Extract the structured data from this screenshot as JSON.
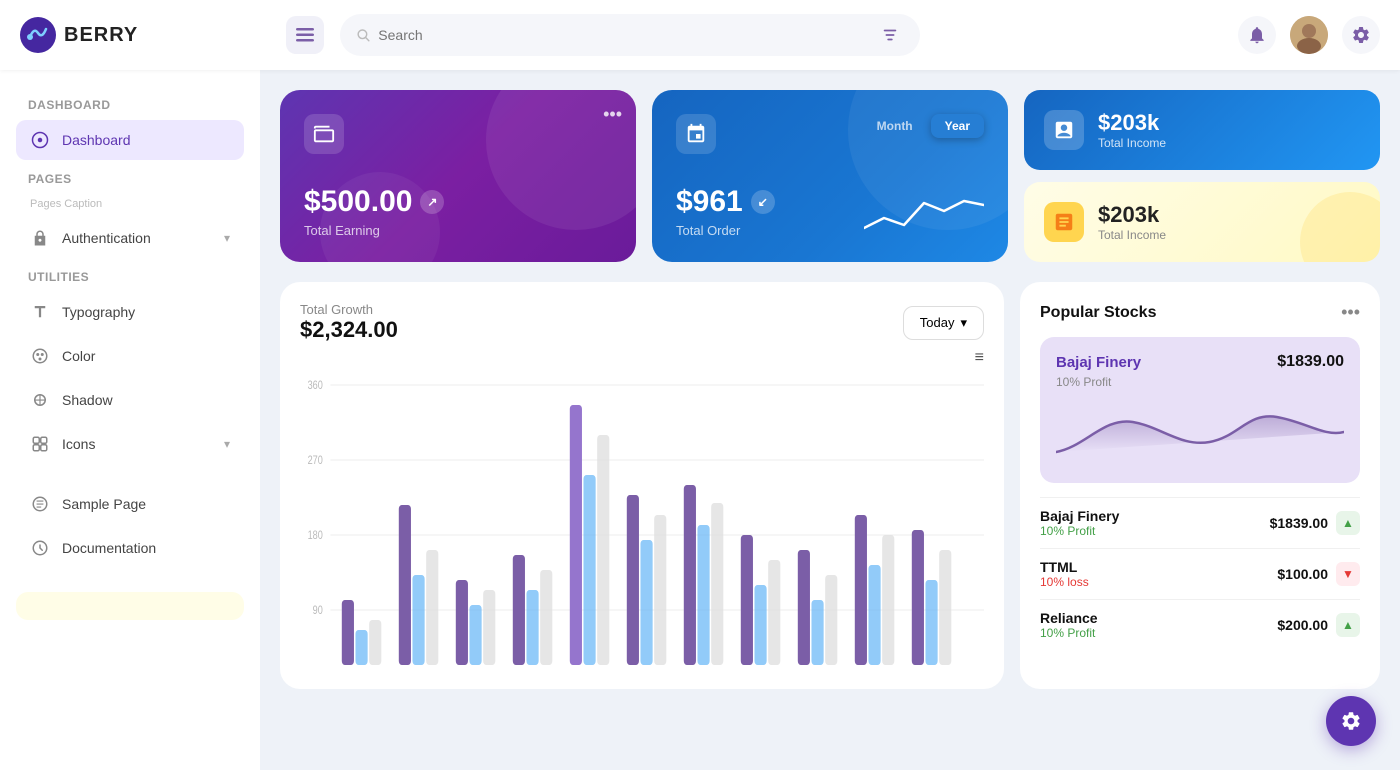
{
  "header": {
    "logo_text": "BERRY",
    "search_placeholder": "Search",
    "hamburger_label": "☰"
  },
  "sidebar": {
    "dashboard_section": "Dashboard",
    "dashboard_item": "Dashboard",
    "pages_section": "Pages",
    "pages_caption": "Pages Caption",
    "auth_item": "Authentication",
    "utilities_section": "Utilities",
    "typography_item": "Typography",
    "color_item": "Color",
    "shadow_item": "Shadow",
    "icons_item": "Icons",
    "sample_page_item": "Sample Page",
    "documentation_item": "Documentation"
  },
  "cards": {
    "earning_amount": "$500.00",
    "earning_label": "Total Earning",
    "order_amount": "$961",
    "order_label": "Total Order",
    "tab_month": "Month",
    "tab_year": "Year",
    "income_blue_amount": "$203k",
    "income_blue_label": "Total Income",
    "income_yellow_amount": "$203k",
    "income_yellow_label": "Total Income"
  },
  "growth": {
    "title": "Total Growth",
    "amount": "$2,324.00",
    "today_btn": "Today",
    "y360": "360",
    "y270": "270",
    "y180": "180",
    "y90": "90"
  },
  "stocks": {
    "title": "Popular Stocks",
    "featured_name": "Bajaj Finery",
    "featured_price": "$1839.00",
    "featured_profit": "10% Profit",
    "items": [
      {
        "name": "Bajaj Finery",
        "price": "$1839.00",
        "profit": "10% Profit",
        "trend": "up"
      },
      {
        "name": "TTML",
        "price": "$100.00",
        "profit": "10% loss",
        "trend": "down"
      },
      {
        "name": "Reliance",
        "price": "$200.00",
        "profit": "10% Profit",
        "trend": "up"
      }
    ]
  }
}
